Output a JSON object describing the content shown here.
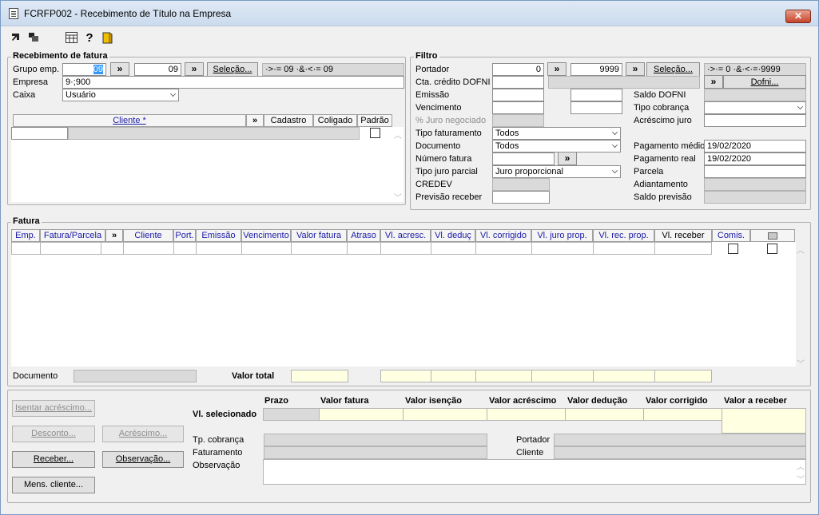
{
  "window": {
    "title": "FCRFP002 - Recebimento de Título na Empresa",
    "close_label": "✕"
  },
  "receb": {
    "title": "Recebimento de fatura",
    "grupo_label": "Grupo emp.",
    "grupo_from": "09",
    "grupo_to": "09",
    "selecao": "Seleção...",
    "range": "·>·= 09 ·&·<·= 09",
    "empresa_label": "Empresa",
    "empresa_value": "9·;900",
    "caixa_label": "Caixa",
    "caixa_value": "Usuário",
    "cols": {
      "cliente": "Cliente *",
      "more": "»",
      "cadastro": "Cadastro",
      "coligado": "Coligado",
      "padrao": "Padrão"
    }
  },
  "filtro": {
    "title": "Filtro",
    "portador_label": "Portador",
    "portador_from": "0",
    "portador_to": "9999",
    "selecao": "Seleção...",
    "range": "·>·= 0 ·&·<·=·9999",
    "cta_label": "Cta. crédito DOFNI",
    "dofni_btn": "Dofni...",
    "emissao_label": "Emissão",
    "vencimento_label": "Vencimento",
    "juro_neg_label": "% Juro negociado",
    "tipo_fat_label": "Tipo faturamento",
    "tipo_fat_value": "Todos",
    "documento_label": "Documento",
    "documento_value": "Todos",
    "num_fatura_label": "Número fatura",
    "tipo_juro_label": "Tipo juro parcial",
    "tipo_juro_value": "Juro proporcional",
    "credev_label": "CREDEV",
    "previsao_label": "Previsão receber",
    "saldo_dofni_label": "Saldo DOFNI",
    "tipo_cob_label": "Tipo cobrança",
    "acresc_label": "Acréscimo juro",
    "pag_medio_label": "Pagamento médio",
    "pag_medio_value": "19/02/2020",
    "pag_real_label": "Pagamento real",
    "pag_real_value": "19/02/2020",
    "parcela_label": "Parcela",
    "adiant_label": "Adiantamento",
    "saldo_prev_label": "Saldo previsão"
  },
  "fatura": {
    "title": "Fatura",
    "cols": [
      "Emp.",
      "Fatura/Parcela",
      "»",
      "Cliente",
      "Port.",
      "Emissão",
      "Vencimento",
      "Valor fatura",
      "Atraso",
      "Vl. acresc.",
      "Vl. deduç",
      "Vl. corrigido",
      "Vl. juro prop.",
      "Vl. rec. prop.",
      "Vl. receber",
      "Comis."
    ],
    "documento_label": "Documento",
    "valor_total_label": "Valor total"
  },
  "bottom": {
    "isentar": "Isentar acréscimo...",
    "desconto": "Desconto...",
    "acrescimo": "Acréscimo...",
    "receber": "Receber...",
    "observacao_btn": "Observação...",
    "mens": "Mens. cliente...",
    "vl_sel_label": "Vl. selecionado",
    "h_prazo": "Prazo",
    "h_valor_fatura": "Valor fatura",
    "h_valor_isencao": "Valor isenção",
    "h_valor_acrescimo": "Valor acréscimo",
    "h_valor_deducao": "Valor dedução",
    "h_valor_corrigido": "Valor corrigido",
    "h_valor_receber": "Valor a receber",
    "tp_cob_label": "Tp. cobrança",
    "faturamento_label": "Faturamento",
    "observacao_label": "Observação",
    "portador_label": "Portador",
    "cliente_label": "Cliente"
  }
}
